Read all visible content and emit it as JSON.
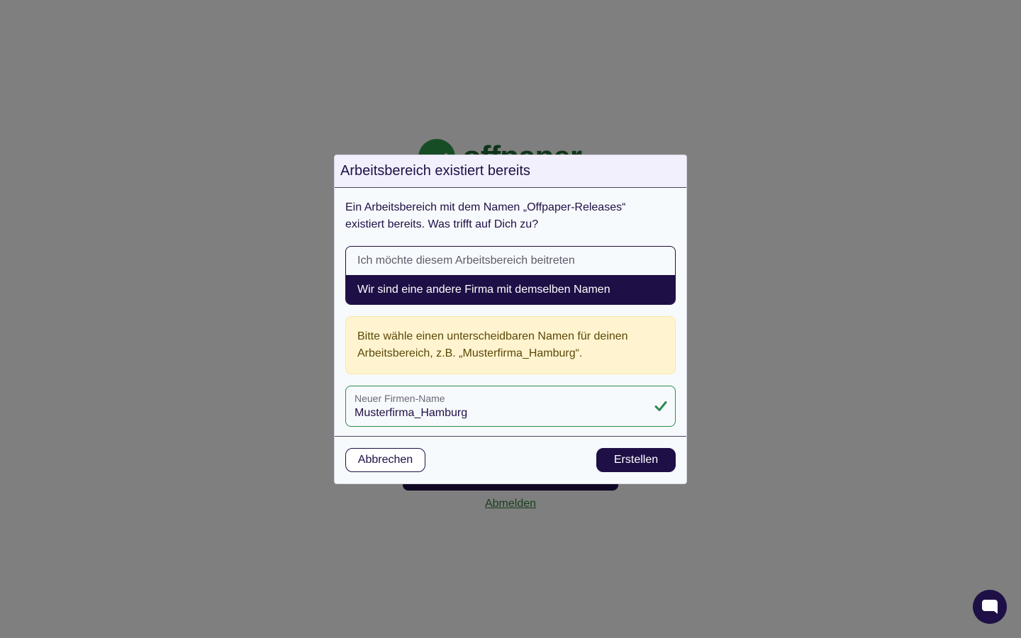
{
  "background": {
    "logo_text": "offpaper",
    "logout_link": "Abmelden"
  },
  "modal": {
    "title": "Arbeitsbereich existiert bereits",
    "message": "Ein Arbeitsbereich mit dem Namen „Offpaper-Releases“ existiert bereits. Was trifft auf Dich zu?",
    "options": [
      {
        "label": "Ich möchte diesem Arbeitsbereich beitreten",
        "selected": false
      },
      {
        "label": "Wir sind eine andere Firma mit demselben Namen",
        "selected": true
      }
    ],
    "warning": "Bitte wähle einen unterscheidbaren Namen für deinen Arbeitsbereich, z.B. „Musterfirma_Hamburg“.",
    "field": {
      "label": "Neuer Firmen-Name",
      "value": "Musterfirma_Hamburg",
      "status_icon": "check-icon"
    },
    "buttons": {
      "cancel": "Abbrechen",
      "create": "Erstellen"
    }
  },
  "chat": {
    "icon": "chat-bubble-icon"
  },
  "colors": {
    "primary": "#1e0f46",
    "success": "#2c8a52",
    "warning_bg": "#fff4cf",
    "warning_text": "#5c4708",
    "header_bg": "#f2f0fd"
  }
}
